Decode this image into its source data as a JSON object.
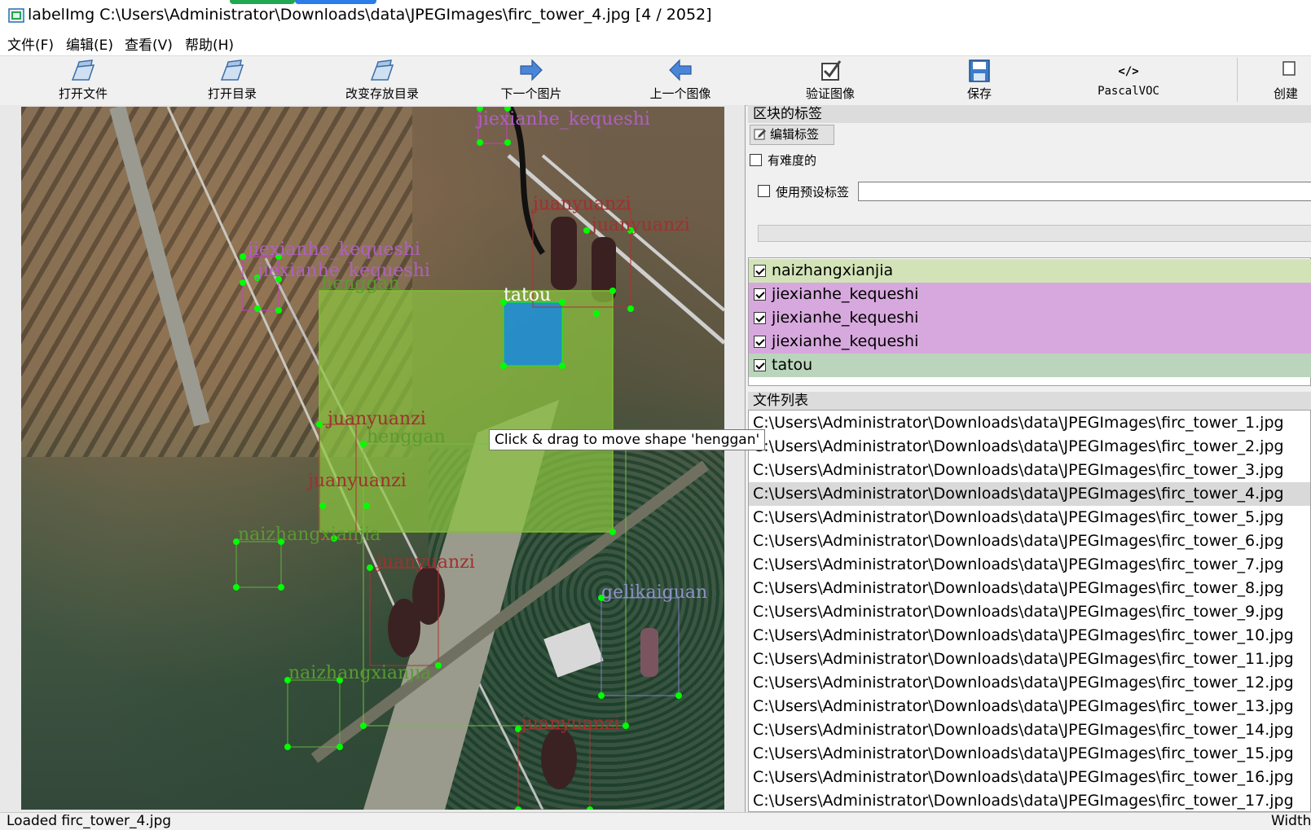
{
  "window": {
    "title": "labelImg C:\\Users\\Administrator\\Downloads\\data\\JPEGImages\\firc_tower_4.jpg [4 / 2052]",
    "accent_colors": [
      "#1fa84f",
      "#2b7de9"
    ]
  },
  "menu": [
    {
      "label": "文件(F)"
    },
    {
      "label": "编辑(E)"
    },
    {
      "label": "查看(V)"
    },
    {
      "label": "帮助(H)"
    }
  ],
  "toolbar": {
    "buttons": [
      {
        "label": "打开文件",
        "icon": "folder-open-icon"
      },
      {
        "label": "打开目录",
        "icon": "folder-open-icon"
      },
      {
        "label": "改变存放目录",
        "icon": "folder-open-icon"
      },
      {
        "label": "下一个图片",
        "icon": "arrow-right-icon"
      },
      {
        "label": "上一个图像",
        "icon": "arrow-left-icon"
      },
      {
        "label": "验证图像",
        "icon": "verify-check-icon"
      },
      {
        "label": "保存",
        "icon": "save-floppy-icon"
      },
      {
        "label": "PascalVOC",
        "icon": "code-tag-icon"
      },
      {
        "label": "创建",
        "icon": "create-rect-icon"
      }
    ]
  },
  "canvas": {
    "tooltip": "Click & drag to move shape 'henggan'",
    "shape_labels": [
      "jiexianhe_kequeshi",
      "juanyuanzi",
      "juanyuanzi",
      "jiexianhe_kequeshi",
      "jiexianhe_kequeshi",
      "henggan",
      "tatou",
      "juanyuanzi",
      "henggan",
      "juanyuanzi",
      "naizhangxianjia",
      "juanyuanzi",
      "gelikaiguan",
      "naizhangxianjia",
      "juanyuanzi"
    ],
    "colors": {
      "henggan_fill": "#8cc63f",
      "tatou_fill": "#1f8bd6",
      "vertex": "#00ff00"
    }
  },
  "panel": {
    "block_labels_title": "区块的标签",
    "edit_label_button": "编辑标签",
    "difficult_label": "有难度的",
    "use_preset_label": "使用预设标签",
    "preset_value": "",
    "labels": [
      {
        "name": "naizhangxianjia",
        "color": "#d3e3b8"
      },
      {
        "name": "jiexianhe_kequeshi",
        "color": "#d7a8dd"
      },
      {
        "name": "jiexianhe_kequeshi",
        "color": "#d7a8dd"
      },
      {
        "name": "jiexianhe_kequeshi",
        "color": "#d7a8dd"
      },
      {
        "name": "tatou",
        "color": "#bad5bb"
      }
    ],
    "file_list_title": "文件列表",
    "files": [
      "C:\\Users\\Administrator\\Downloads\\data\\JPEGImages\\firc_tower_1.jpg",
      "C:\\Users\\Administrator\\Downloads\\data\\JPEGImages\\firc_tower_2.jpg",
      "C:\\Users\\Administrator\\Downloads\\data\\JPEGImages\\firc_tower_3.jpg",
      "C:\\Users\\Administrator\\Downloads\\data\\JPEGImages\\firc_tower_4.jpg",
      "C:\\Users\\Administrator\\Downloads\\data\\JPEGImages\\firc_tower_5.jpg",
      "C:\\Users\\Administrator\\Downloads\\data\\JPEGImages\\firc_tower_6.jpg",
      "C:\\Users\\Administrator\\Downloads\\data\\JPEGImages\\firc_tower_7.jpg",
      "C:\\Users\\Administrator\\Downloads\\data\\JPEGImages\\firc_tower_8.jpg",
      "C:\\Users\\Administrator\\Downloads\\data\\JPEGImages\\firc_tower_9.jpg",
      "C:\\Users\\Administrator\\Downloads\\data\\JPEGImages\\firc_tower_10.jpg",
      "C:\\Users\\Administrator\\Downloads\\data\\JPEGImages\\firc_tower_11.jpg",
      "C:\\Users\\Administrator\\Downloads\\data\\JPEGImages\\firc_tower_12.jpg",
      "C:\\Users\\Administrator\\Downloads\\data\\JPEGImages\\firc_tower_13.jpg",
      "C:\\Users\\Administrator\\Downloads\\data\\JPEGImages\\firc_tower_14.jpg",
      "C:\\Users\\Administrator\\Downloads\\data\\JPEGImages\\firc_tower_15.jpg",
      "C:\\Users\\Administrator\\Downloads\\data\\JPEGImages\\firc_tower_16.jpg",
      "C:\\Users\\Administrator\\Downloads\\data\\JPEGImages\\firc_tower_17.jpg"
    ],
    "selected_file_index": 3
  },
  "status": {
    "left": "Loaded firc_tower_4.jpg",
    "right": "Width"
  }
}
